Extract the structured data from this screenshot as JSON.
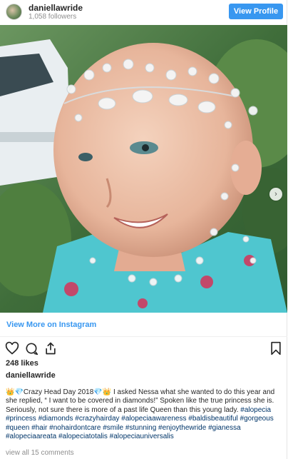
{
  "header": {
    "username": "daniellawride",
    "followers": "1,058 followers",
    "view_profile_label": "View Profile"
  },
  "photo": {
    "alt": "Child wearing crystal hair vine",
    "carousel_next_glyph": "›"
  },
  "view_more_label": "View More on Instagram",
  "actions": {
    "icons": [
      "heart-icon",
      "comment-icon",
      "share-icon",
      "bookmark-icon"
    ]
  },
  "likes": "248 likes",
  "caption": {
    "username": "daniellawride",
    "text": "👑💎Crazy Head Day 2018💎👑 I asked Nessa what she wanted to do this year and she replied, “ I want to be covered in diamonds!” Spoken like the true princess she is. Seriously, not sure there is more of a past life Queen than this young lady.",
    "hashtags": "#alopecia #princess #diamonds #crazyhairday #alopeciaawareness #baldisbeautiful #gorgeous #queen #hair #nohairdontcare #smile #stunning #enjoythewride #gianessa #alopeciaareata #alopeciatotalis #alopeciauniversalis"
  },
  "comments_label": "view all 15 comments",
  "colors": {
    "accent": "#3897f0",
    "hashtag": "#003569",
    "muted": "#8e8e8e"
  }
}
